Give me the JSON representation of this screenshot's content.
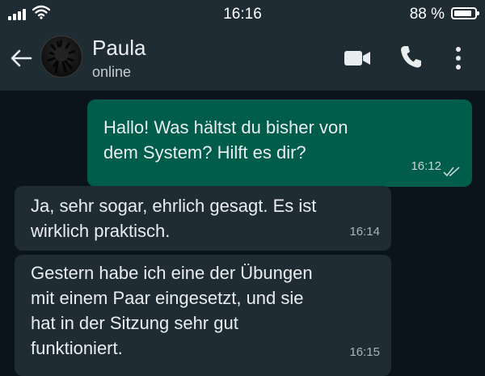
{
  "status_bar": {
    "time": "16:16",
    "battery_percent": "88 %",
    "battery_level": 0.88,
    "icons": [
      "signal-icon",
      "wifi-icon",
      "battery-icon"
    ]
  },
  "header": {
    "contact_name": "Paula",
    "contact_status": "online",
    "icons": [
      "back-arrow-icon",
      "avatar",
      "video-call-icon",
      "phone-call-icon",
      "more-options-icon"
    ]
  },
  "messages": [
    {
      "direction": "outgoing",
      "text": "Hallo! Was hältst du bisher von\ndem System? Hilft es dir?",
      "time": "16:12",
      "status_icon": "double-check-icon"
    },
    {
      "direction": "incoming",
      "text": "Ja, sehr sogar, ehrlich gesagt. Es ist\nwirklich praktisch.",
      "time": "16:14"
    },
    {
      "direction": "incoming",
      "text": "Gestern habe ich eine der Übungen\nmit einem Paar eingesetzt, und sie\nhat in der Sitzung sehr gut\nfunktioniert.",
      "time": "16:15"
    }
  ],
  "colors": {
    "background": "#0b141a",
    "header": "#1f2c33",
    "outgoing_bubble": "#005c4b",
    "incoming_bubble": "#1f2c33"
  }
}
